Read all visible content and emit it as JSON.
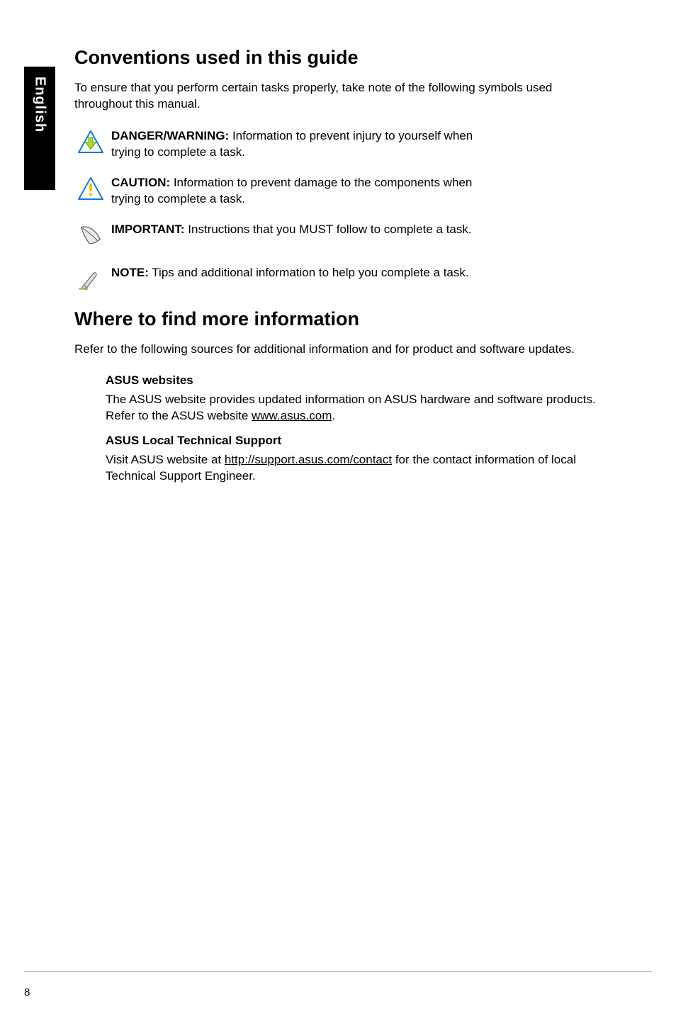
{
  "sidebar": {
    "language": "English"
  },
  "section1": {
    "heading": "Conventions used in this guide",
    "intro": "To ensure that you perform certain tasks properly, take note of the following symbols used throughout this manual.",
    "items": [
      {
        "lead": "DANGER/WARNING: ",
        "body": " Information to prevent injury to yourself when trying to complete a task."
      },
      {
        "lead": "CAUTION:",
        "body": " Information to prevent damage to the components when trying to complete a task."
      },
      {
        "lead": "IMPORTANT:",
        "body": " Instructions that you MUST follow to complete a task."
      },
      {
        "lead": "NOTE:",
        "body": " Tips and additional information to help you complete a task."
      }
    ]
  },
  "section2": {
    "heading": "Where to find more information",
    "intro": "Refer to the following sources for additional information and for product and software updates.",
    "sub1": {
      "heading": "ASUS websites",
      "pre": "The ASUS website provides updated information on ASUS hardware and software products. Refer to the ASUS website ",
      "link": "www.asus.com",
      "post": "."
    },
    "sub2": {
      "heading": "ASUS Local Technical Support",
      "pre": "Visit ASUS website at ",
      "link": "http://support.asus.com/contact",
      "post": " for the contact information of local Technical Support Engineer."
    }
  },
  "page_number": "8"
}
